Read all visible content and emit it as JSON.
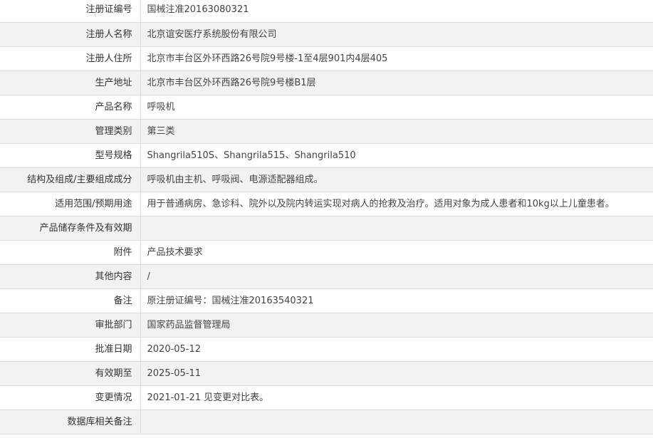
{
  "rows": [
    {
      "label": "注册证编号",
      "value": "国械注准20163080321"
    },
    {
      "label": "注册人名称",
      "value": "北京谊安医疗系统股份有限公司"
    },
    {
      "label": "注册人住所",
      "value": "北京市丰台区外环西路26号院9号楼-1至4层901内4层405"
    },
    {
      "label": "生产地址",
      "value": "北京市丰台区外环西路26号院9号楼B1层"
    },
    {
      "label": "产品名称",
      "value": "呼吸机"
    },
    {
      "label": "管理类别",
      "value": "第三类"
    },
    {
      "label": "型号规格",
      "value": "Shangrila510S、Shangrila515、Shangrila510"
    },
    {
      "label": "结构及组成/主要组成成分",
      "value": "呼吸机由主机、呼吸阀、电源适配器组成。"
    },
    {
      "label": "适用范围/预期用途",
      "value": "用于普通病房、急诊科、院外以及院内转运实现对病人的抢救及治疗。适用对象为成人患者和10kg以上儿童患者。"
    },
    {
      "label": "产品储存条件及有效期",
      "value": ""
    },
    {
      "label": "附件",
      "value": "产品技术要求"
    },
    {
      "label": "其他内容",
      "value": "/"
    },
    {
      "label": "备注",
      "value": "原注册证编号：国械注准20163540321"
    },
    {
      "label": "审批部门",
      "value": "国家药品监督管理局"
    },
    {
      "label": "批准日期",
      "value": "2020-05-12"
    },
    {
      "label": "有效期至",
      "value": "2025-05-11"
    },
    {
      "label": "变更情况",
      "value": "2021-01-21 见变更对比表。"
    },
    {
      "label": "数据库相关备注",
      "value": ""
    }
  ]
}
